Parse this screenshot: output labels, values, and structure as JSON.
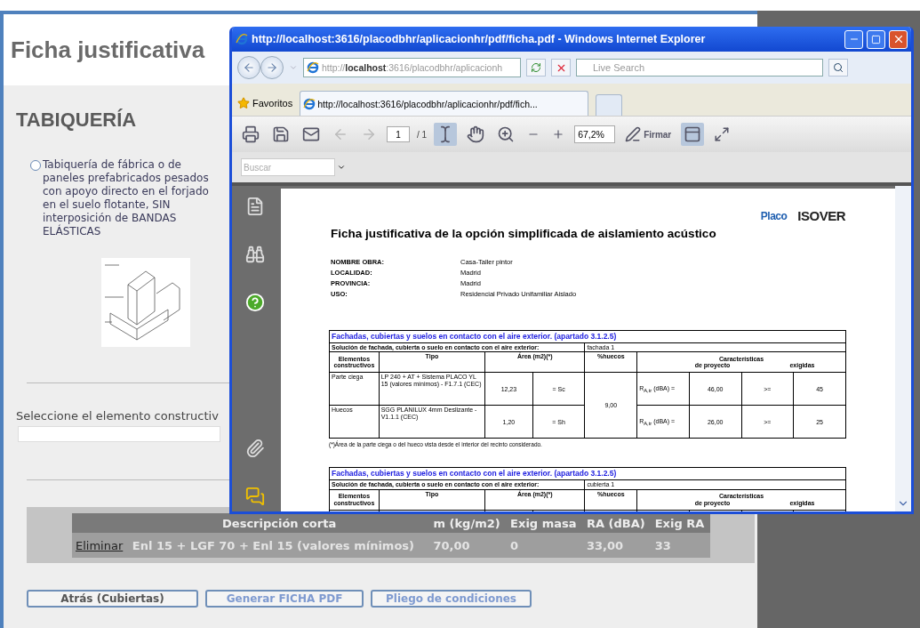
{
  "page": {
    "title": "Ficha justificativa",
    "section": "TABIQUERÍA",
    "option": {
      "label": "Tabiquería de fábrica o de paneles prefabricados pesados con apoyo directo en el forjado en el suelo flotante, SIN interposición de BANDAS ELÁSTICAS",
      "selected": false
    },
    "select_label": "Seleccione el elemento constructiv",
    "list": {
      "columns": [
        "Descripción corta",
        "m (kg/m2)",
        "Exig masa",
        "RA (dBA)",
        "Exig RA"
      ],
      "rows": [
        {
          "action": "Eliminar",
          "cells": [
            "Enl 15 + LGF 70 + Enl 15 (valores mínimos)",
            "70,00",
            "0",
            "33,00",
            "33"
          ]
        }
      ]
    },
    "buttons": [
      {
        "label": "Atrás (Cubiertas)",
        "kind": "back"
      },
      {
        "label": "Generar FICHA PDF",
        "kind": "action"
      },
      {
        "label": "Pliego de condiciones",
        "kind": "action"
      }
    ]
  },
  "popup": {
    "title": "http://localhost:3616/placodbhr/aplicacionhr/pdf/ficha.pdf - Windows Internet Explorer",
    "address": "http://**localhost**:3616/placodbhr/aplicacionh",
    "search_placeholder": "Live Search",
    "favorites": "Favoritos",
    "tabs": [
      {
        "label": "http://localhost:3616/placodbhr/aplicacionhr/pdf/fich...",
        "selected": true
      }
    ],
    "pdf_toolbar": {
      "page": "1",
      "page_total": "/ 1",
      "zoom": "67,2%",
      "sign": "Firmar",
      "find_placeholder": "Buscar"
    },
    "document": {
      "logos": [
        "Placo",
        "ISOVER"
      ],
      "title": "Ficha justificativa de la opción simplificada de aislamiento acústico",
      "meta": [
        {
          "label": "NOMBRE OBRA:",
          "value": "Casa-Taller pintor"
        },
        {
          "label": "LOCALIDAD:",
          "value": "Madrid"
        },
        {
          "label": "PROVINCIA:",
          "value": "Madrid"
        },
        {
          "label": "USO:",
          "value": "Residencial Privado Unifamiliar Aislado"
        }
      ],
      "tables": [
        {
          "title": "Fachadas, cubiertas y suelos en contacto con el aire exterior. (apartado 3.1.2.5)",
          "solution_label": "Solución de fachada, cubierta o suelo en contacto con el aire exterior:",
          "solution": "fachada 1",
          "headers": {
            "elements": "Elementos constructivos",
            "type": "Tipo",
            "area": "Área (m2)(*)",
            "openings": "%huecos",
            "characteristics": "Características",
            "project": "de proyecto",
            "required": "exigidas"
          },
          "openings_value": "9,00",
          "rows": [
            {
              "element": "Parte ciega",
              "type": "LP 240 + AT + Sistema PLACO YL 15 (valores mínimos) - F1.7.1 (CEC)",
              "area": "12,23",
              "symbol": "= Sc",
              "measure": "R$_{A,tr}$ (dBA) =",
              "project": "46,00",
              "op": ">=",
              "required": "45"
            },
            {
              "element": "Huecos",
              "type": "SGG PLANILUX 4mm Deslizante - V1.1.1 (CEC)",
              "area": "1,20",
              "symbol": "= Sh",
              "measure": "R$_{A,tr}$ (dBA) =",
              "project": "26,00",
              "op": ">=",
              "required": "25"
            }
          ],
          "footnote": "(*)Área de la parte ciega o del hueco vista desde el interior del recinto considerado."
        },
        {
          "title": "Fachadas, cubiertas y suelos en contacto con el aire exterior. (apartado 3.1.2.5)",
          "solution_label": "Solución de fachada, cubierta o suelo en contacto con el aire exterior:",
          "solution": "cubierta 1",
          "headers": {
            "elements": "Elementos constructivos",
            "type": "Tipo",
            "area": "Área (m2)(*)",
            "openings": "%huecos",
            "characteristics": "Características",
            "project": "de proyecto",
            "required": "exigidas"
          }
        }
      ]
    }
  }
}
